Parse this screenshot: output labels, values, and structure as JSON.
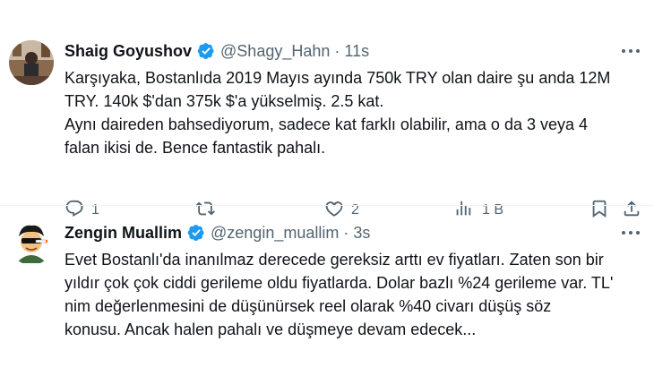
{
  "tweets": [
    {
      "author_name": "Shaig Goyushov",
      "handle": "@Shagy_Hahn",
      "separator": "·",
      "time": "11s",
      "lines": [
        "Karşıyaka, Bostanlıda 2019 Mayıs ayında 750k TRY olan daire şu anda 12M",
        "TRY. 140k $'dan 375k $'a yükselmiş. 2.5 kat.",
        "Aynı daireden bahsediyorum, sadece kat farklı olabilir, ama o da 3 veya 4",
        "falan ikisi de. Bence fantastik pahalı."
      ],
      "actions": {
        "reply_count": "1",
        "retweet_count": "",
        "like_count": "2",
        "views_count": "1 B"
      }
    },
    {
      "author_name": "Zengin Muallim",
      "handle": "@zengin_muallim",
      "separator": "·",
      "time": "3s",
      "lines": [
        "Evet Bostanlı'da inanılmaz derecede gereksiz arttı ev fiyatları. Zaten son bir",
        "yıldır çok çok ciddi gerileme oldu fiyatlarda. Dolar bazlı %24 gerileme var. TL'",
        "nim değerlenmesini de düşünürsek reel olarak %40 civarı düşüş söz",
        "konusu. Ancak halen pahalı ve düşmeye devam edecek..."
      ]
    }
  ],
  "colors": {
    "verified": "#1d9bf0",
    "secondary_text": "#536471",
    "primary_text": "#0f1419"
  },
  "icons": [
    "more-icon",
    "verified-badge-icon",
    "reply-icon",
    "retweet-icon",
    "like-icon",
    "views-icon",
    "bookmark-icon",
    "share-icon"
  ]
}
